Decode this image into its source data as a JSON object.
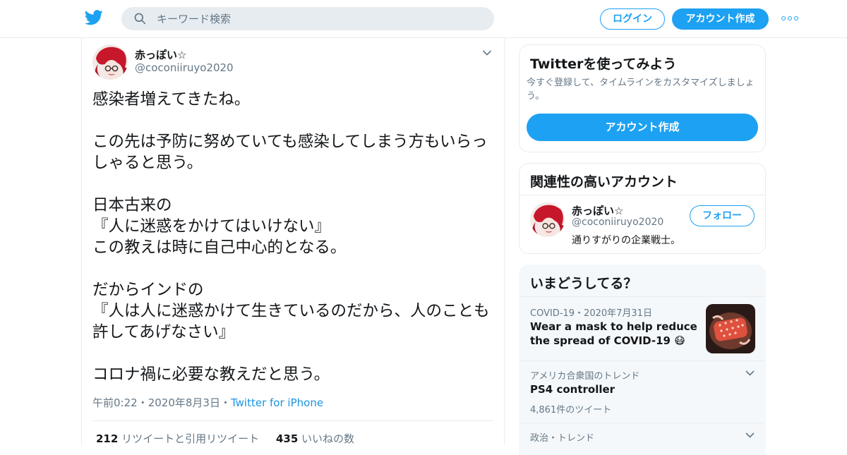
{
  "header": {
    "search_placeholder": "キーワード検索",
    "login_label": "ログイン",
    "signup_label": "アカウント作成"
  },
  "tweet": {
    "display_name": "赤っぽい☆",
    "handle": "@coconiiruyo2020",
    "text": "感染者増えてきたね。\n\nこの先は予防に努めていても感染してしまう方もいらっしゃると思う。\n\n日本古来の\n『人に迷惑をかけてはいけない』\nこの教えは時に自己中心的となる。\n\nだからインドの\n『人は人に迷惑かけて生きているのだから、人のことも許してあげなさい』\n\nコロナ禍に必要な教えだと思う。",
    "time": "午前0:22",
    "date": "2020年8月3日",
    "source": "Twitter for iPhone",
    "retweets_count": "212",
    "retweets_label": "リツイートと引用リツイート",
    "likes_count": "435",
    "likes_label": "いいねの数"
  },
  "signup_card": {
    "title": "Twitterを使ってみよう",
    "subtitle": "今すぐ登録して、タイムラインをカスタマイズしましょう。",
    "button": "アカウント作成"
  },
  "related": {
    "title": "関連性の高いアカウント",
    "name": "赤っぽい☆",
    "handle": "@coconiiruyo2020",
    "bio": "通りすがりの企業戦士。",
    "follow_label": "フォロー"
  },
  "trends": {
    "title": "いまどうしてる？",
    "items": [
      {
        "context": "COVID-19・2020年7月31日",
        "title": "Wear a mask to help reduce the spread of COVID-19 😷",
        "count": ""
      },
      {
        "context": "アメリカ合衆国のトレンド",
        "title": "PS4 controller",
        "count": "4,861件のツイート"
      },
      {
        "context": "政治・トレンド",
        "title": "",
        "count": ""
      }
    ]
  },
  "colors": {
    "accent": "#1da1f2",
    "link": "#1b95e0",
    "muted": "#657786"
  }
}
